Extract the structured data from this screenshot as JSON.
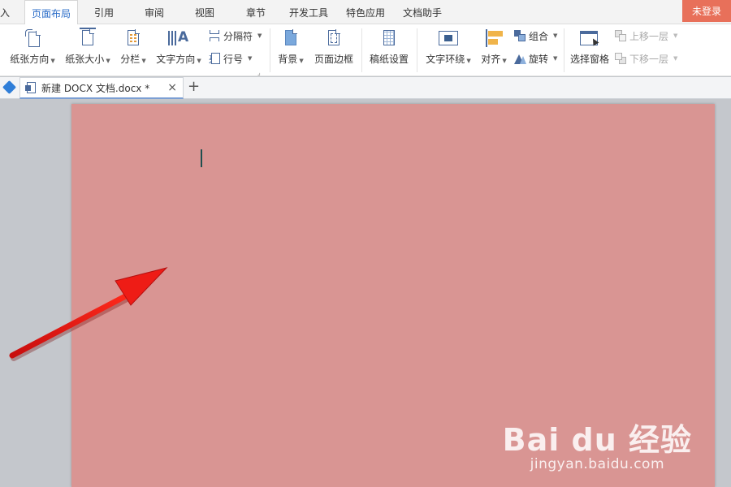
{
  "menu": {
    "tabs": [
      {
        "label": "入"
      },
      {
        "label": "页面布局"
      },
      {
        "label": "引用"
      },
      {
        "label": "审阅"
      },
      {
        "label": "视图"
      },
      {
        "label": "章节"
      },
      {
        "label": "开发工具"
      },
      {
        "label": "特色应用"
      },
      {
        "label": "文档助手"
      }
    ],
    "active_tab": "页面布局",
    "login_label": "未登录"
  },
  "ribbon": {
    "paper_orientation": "纸张方向",
    "paper_size": "纸张大小",
    "columns": "分栏",
    "text_direction": "文字方向",
    "separator": "分隔符",
    "line_number": "行号",
    "background": "背景",
    "page_border": "页面边框",
    "manuscript_settings": "稿纸设置",
    "text_wrap": "文字环绕",
    "align": "对齐",
    "group": "组合",
    "rotate": "旋转",
    "selection_pane": "选择窗格",
    "bring_forward": "上移一层",
    "send_backward": "下移一层"
  },
  "doc_tab": {
    "title": "新建 DOCX 文档.docx *",
    "close": "×",
    "add": "+"
  },
  "page": {
    "background_color": "#d99593"
  },
  "watermark": {
    "logo": "Bai du 经验",
    "url": "jingyan.baidu.com"
  },
  "colors": {
    "accent": "#2a6cc8",
    "login_bg": "#e8705a",
    "annotation_arrow": "#e01010"
  }
}
